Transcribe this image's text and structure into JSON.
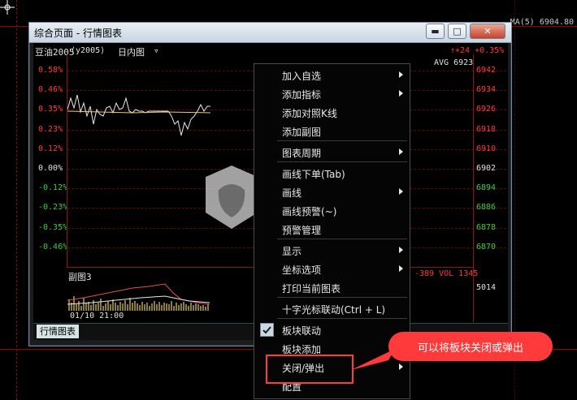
{
  "top": {
    "ma_readout": "MA(5) 6904.80"
  },
  "window": {
    "title": "综合页面 - 行情图表"
  },
  "chart": {
    "header": {
      "symbol": "豆油2005",
      "period": "日内图",
      "change": "↑+24 +0.35%",
      "avg": "AVG 6923"
    },
    "y_left": [
      "0.58%",
      "0.46%",
      "0.35%",
      "0.23%",
      "0.12%",
      "0.00%",
      "-0.12%",
      "-0.23%",
      "-0.35%",
      "-0.46%"
    ],
    "y_right": [
      "6942",
      "6934",
      "6926",
      "6918",
      "6910",
      "6902",
      "6894",
      "6886",
      "6878",
      "6870"
    ],
    "sub_title": "副图3",
    "sub_readout": "-389  VOL 1345",
    "sub_right": "5014",
    "x_label": "01/10 21:00"
  },
  "tabbar": {
    "tab": "行情图表"
  },
  "menu": {
    "items": [
      {
        "label": "加入自选",
        "has_sub": true
      },
      {
        "label": "添加指标",
        "has_sub": true
      },
      {
        "label": "添加对照K线",
        "has_sub": false
      },
      {
        "label": "添加副图",
        "has_sub": false
      },
      {
        "label": "图表周期",
        "has_sub": true
      },
      {
        "label": "画线下单(Tab)",
        "has_sub": false
      },
      {
        "label": "画线",
        "has_sub": true
      },
      {
        "label": "画线预警(~)",
        "has_sub": false
      },
      {
        "label": "预警管理",
        "has_sub": false
      },
      {
        "label": "显示",
        "has_sub": true
      },
      {
        "label": "坐标选项",
        "has_sub": true
      },
      {
        "label": "打印当前图表",
        "has_sub": false
      },
      {
        "label": "十字光标联动(Ctrl + L)",
        "has_sub": false
      },
      {
        "label": "板块联动",
        "has_sub": false,
        "checked": true
      },
      {
        "label": "板块添加",
        "has_sub": false
      },
      {
        "label": "关闭/弹出",
        "has_sub": true
      },
      {
        "label": "配置",
        "has_sub": false
      }
    ]
  },
  "callout": {
    "text": "可以将板块关闭或弹出"
  },
  "colors": {
    "up": "#ff3b3b",
    "down": "#3ccf3c",
    "highlight": "#ff3b3b",
    "callout": "#ff3a3a"
  }
}
